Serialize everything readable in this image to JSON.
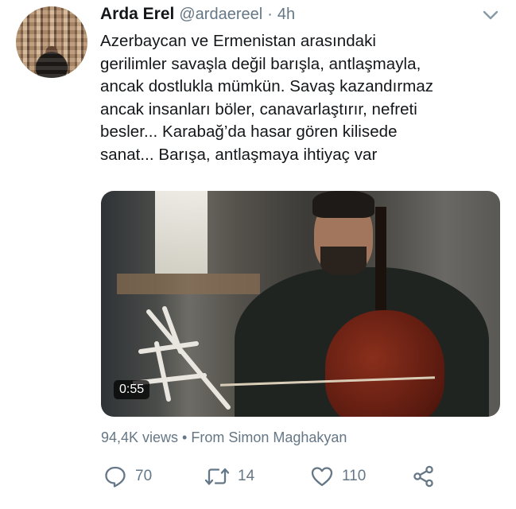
{
  "author": {
    "name": "Arda Erel",
    "handle": "@ardaereel",
    "separator": "·",
    "time": "4h"
  },
  "tweet": {
    "lines": [
      "Azerbaycan ve Ermenistan arasındaki",
      "gerilimler savaşla değil barışla, antlaşmayla,",
      "ancak dostlukla mümkün. Savaş kazandırmaz",
      "ancak insanları böler, canavarlaştırır, nefreti",
      "besler... Karabağ’da hasar gören kilisede",
      "sanat... Barışa, antlaşmaya ihtiyaç var"
    ]
  },
  "media": {
    "duration": "0:55"
  },
  "meta": {
    "text": "94,4K views • From Simon Maghakyan"
  },
  "actions": {
    "replies": "70",
    "retweets": "14",
    "likes": "110"
  },
  "icons": {
    "reply": "reply-icon",
    "retweet": "retweet-icon",
    "like": "heart-icon",
    "share": "share-icon",
    "menu": "chevron-down-icon"
  },
  "colors": {
    "text": "#14171a",
    "muted": "#657786",
    "background": "#ffffff"
  }
}
